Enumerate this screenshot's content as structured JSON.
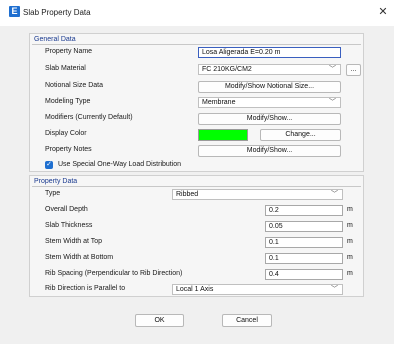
{
  "window": {
    "title": "Slab Property Data",
    "close_glyph": "✕",
    "app_icon_glyph": "E",
    "accent": "#1f6fd0"
  },
  "general": {
    "title": "General Data",
    "property_name_label": "Property Name",
    "property_name_value": "Losa Aligerada E=0.20 m",
    "slab_material_label": "Slab Material",
    "slab_material_value": "FC 210KG/CM2",
    "slab_material_more": "...",
    "notional_label": "Notional Size Data",
    "notional_button": "Modify/Show Notional Size...",
    "modeling_type_label": "Modeling Type",
    "modeling_type_value": "Membrane",
    "modifiers_label": "Modifiers (Currently Default)",
    "modifiers_button": "Modify/Show...",
    "display_color_label": "Display Color",
    "display_color_value": "#00ff00",
    "display_color_button": "Change...",
    "property_notes_label": "Property Notes",
    "property_notes_button": "Modify/Show...",
    "one_way_checkbox_label": "Use Special One-Way Load Distribution",
    "one_way_checked": true
  },
  "property": {
    "title": "Property Data",
    "type_label": "Type",
    "type_value": "Ribbed",
    "rows": [
      {
        "label": "Overall Depth",
        "value": "0.2",
        "unit": "m"
      },
      {
        "label": "Slab Thickness",
        "value": "0.05",
        "unit": "m"
      },
      {
        "label": "Stem Width at Top",
        "value": "0.1",
        "unit": "m"
      },
      {
        "label": "Stem Width at Bottom",
        "value": "0.1",
        "unit": "m"
      },
      {
        "label": "Rib Spacing (Perpendicular to Rib Direction)",
        "value": "0.4",
        "unit": "m"
      }
    ],
    "rib_direction_label": "Rib Direction is Parallel to",
    "rib_direction_value": "Local 1 Axis"
  },
  "footer": {
    "ok": "OK",
    "cancel": "Cancel"
  }
}
